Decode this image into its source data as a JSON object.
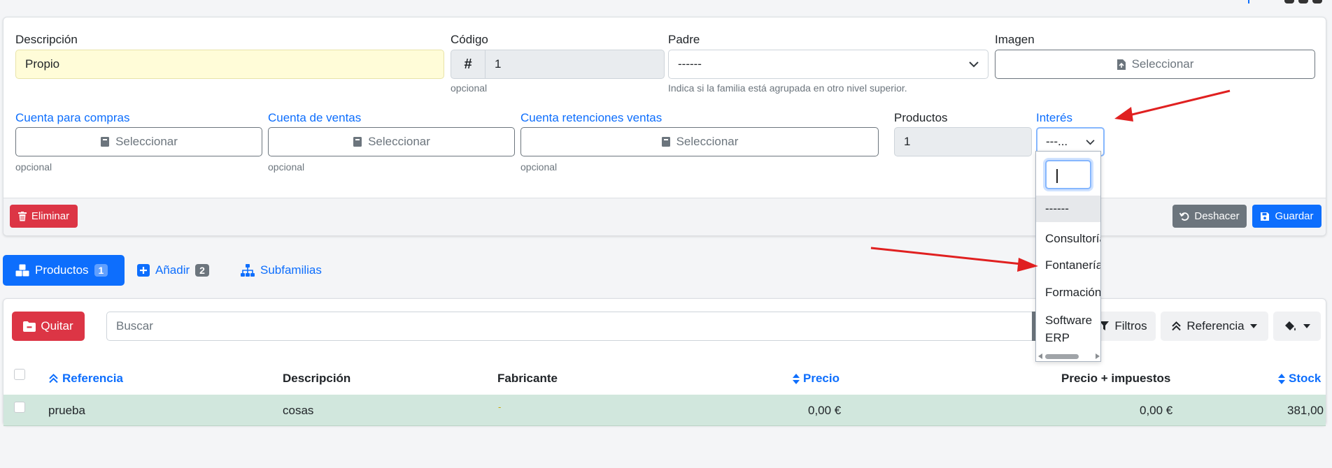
{
  "form": {
    "descripcion": {
      "label": "Descripción",
      "value": "Propio"
    },
    "codigo": {
      "label": "Código",
      "prefix": "#",
      "value": "1",
      "help": "opcional"
    },
    "padre": {
      "label": "Padre",
      "value": "------",
      "help": "Indica si la familia está agrupada en otro nivel superior."
    },
    "imagen": {
      "label": "Imagen",
      "button": "Seleccionar"
    },
    "cuenta_compras": {
      "label": "Cuenta para compras",
      "button": "Seleccionar",
      "help": "opcional"
    },
    "cuenta_ventas": {
      "label": "Cuenta de ventas",
      "button": "Seleccionar",
      "help": "opcional"
    },
    "cuenta_retenciones": {
      "label": "Cuenta retenciones ventas",
      "button": "Seleccionar",
      "help": "opcional"
    },
    "productos": {
      "label": "Productos",
      "value": "1"
    },
    "interes": {
      "label": "Interés",
      "value": "---..."
    }
  },
  "footer": {
    "eliminar": "Eliminar",
    "deshacer": "Deshacer",
    "guardar": "Guardar"
  },
  "tabs": [
    {
      "label": "Productos",
      "badge": "1",
      "active": true
    },
    {
      "label": "Añadir",
      "badge": "2",
      "active": false
    },
    {
      "label": "Subfamilias",
      "active": false
    }
  ],
  "list": {
    "quitar": "Quitar",
    "search_placeholder": "Buscar",
    "filtros": "Filtros",
    "referencia": "Referencia",
    "columns": [
      "Referencia",
      "Descripción",
      "Fabricante",
      "Precio",
      "Precio + impuestos",
      "Stock"
    ],
    "rows": [
      {
        "referencia": "prueba",
        "descripcion": "cosas",
        "fabricante": "-",
        "precio": "0,00 €",
        "precio_impuestos": "0,00 €",
        "stock": "381,00"
      }
    ]
  },
  "dropdown": {
    "options": [
      "------",
      "Consultoría",
      "Fontanería",
      "Formación",
      "Software ERP"
    ]
  },
  "colors": {
    "primary": "#0d6efd",
    "danger": "#dc3545",
    "secondary": "#6c757d",
    "row_highlight": "#d1e7dd",
    "annotation_arrow": "#e02020"
  }
}
